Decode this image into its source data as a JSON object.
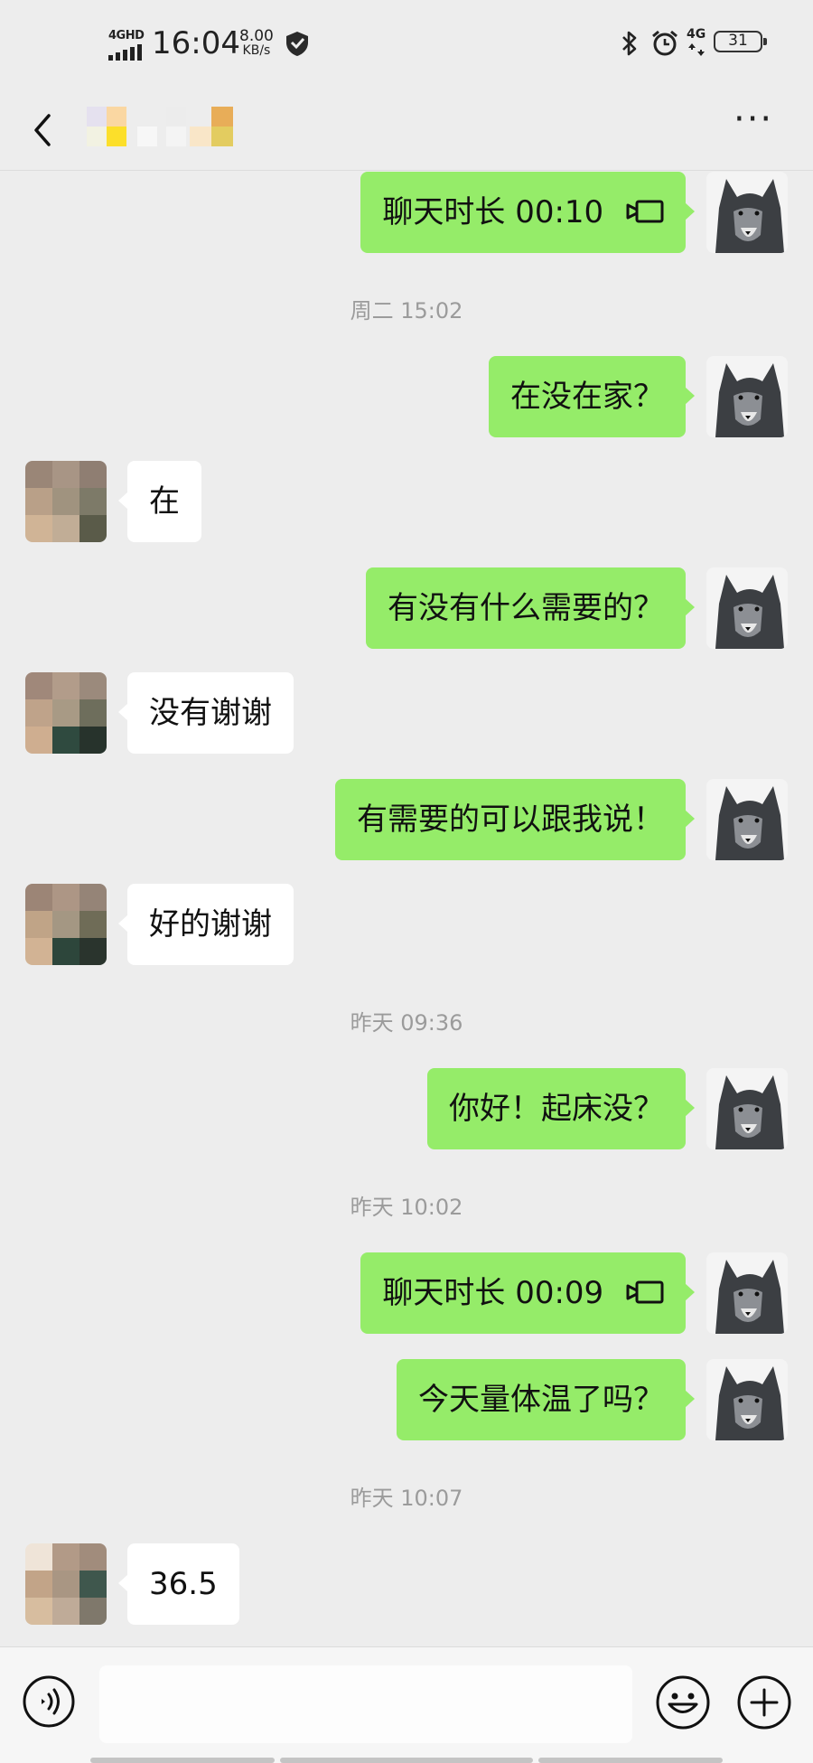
{
  "status_bar": {
    "network_tag": "4GHD",
    "time": "16:04",
    "speed_value": "8.00",
    "speed_unit": "KB/s",
    "mobile_data": "4G",
    "battery_level": "31"
  },
  "header": {
    "back_icon": "chevron-left-icon",
    "more_icon": "more-dots-icon",
    "contact_name_pixelated": true
  },
  "messages": [
    {
      "type": "video_call",
      "side": "me",
      "text": "聊天时长 00:10"
    },
    {
      "type": "time",
      "text": "周二 15:02"
    },
    {
      "type": "text",
      "side": "me",
      "text": "在没在家？"
    },
    {
      "type": "text",
      "side": "them",
      "text": "在"
    },
    {
      "type": "text",
      "side": "me",
      "text": "有没有什么需要的？"
    },
    {
      "type": "text",
      "side": "them",
      "text": "没有谢谢"
    },
    {
      "type": "text",
      "side": "me",
      "text": "有需要的可以跟我说！"
    },
    {
      "type": "text",
      "side": "them",
      "text": "好的谢谢"
    },
    {
      "type": "time",
      "text": "昨天 09:36"
    },
    {
      "type": "text",
      "side": "me",
      "text": "你好！起床没？"
    },
    {
      "type": "time",
      "text": "昨天 10:02"
    },
    {
      "type": "video_call",
      "side": "me",
      "text": "聊天时长 00:09"
    },
    {
      "type": "text",
      "side": "me",
      "text": "今天量体温了吗？"
    },
    {
      "type": "time",
      "text": "昨天 10:07"
    },
    {
      "type": "text",
      "side": "them",
      "text": "36.5"
    }
  ],
  "input_bar": {
    "voice_icon": "voice-icon",
    "emoji_icon": "emoji-icon",
    "plus_icon": "plus-icon",
    "input_value": ""
  },
  "colors": {
    "background": "#ededed",
    "my_bubble": "#95ec69",
    "their_bubble": "#ffffff",
    "timestamp": "#9b9b9b"
  }
}
